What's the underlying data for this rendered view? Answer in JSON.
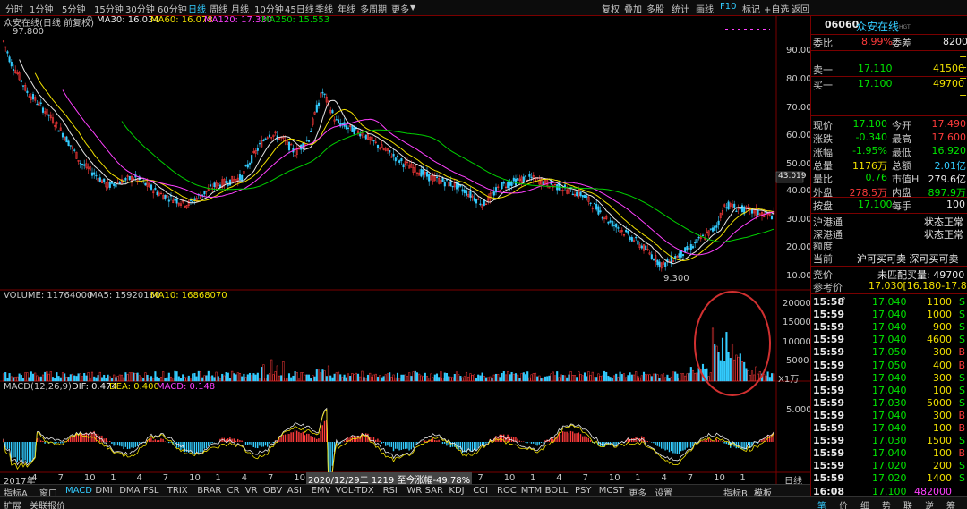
{
  "toolbar": {
    "timeframes": [
      "分时",
      "1分钟",
      "5分钟",
      "15分钟",
      "30分钟",
      "60分钟",
      "日线",
      "周线",
      "月线",
      "10分钟",
      "45日线",
      "季线",
      "年线",
      "多周期",
      "更多"
    ],
    "active_timeframe": "日线",
    "tools": [
      "复权",
      "叠加",
      "多股",
      "统计",
      "画线",
      "F10",
      "标记",
      "+自选",
      "返回"
    ]
  },
  "chart_header": {
    "stock_name": "众安在线(日线 前复权)",
    "ma30": "MA30: 16.034",
    "ma60": "MA60: 16.078",
    "ma120": "MA120: 17.330",
    "ma250": "MA250: 15.553",
    "high_marker": "97.800",
    "low_marker": "9.300",
    "current_price_box": "43.019"
  },
  "price_axis": [
    "90.00",
    "80.00",
    "70.00",
    "60.00",
    "50.00",
    "40.00",
    "30.00",
    "20.00",
    "10.00"
  ],
  "volume_header": {
    "volume": "VOLUME: 11764000",
    "ma5": "MA5: 15920160",
    "ma10": "MA10: 16868070"
  },
  "volume_axis": [
    "20000",
    "15000",
    "10000",
    "5000",
    "X1万"
  ],
  "macd_header": {
    "macd_label": "MACD(12,26,9)",
    "dif": "DIF: 0.474",
    "dea": "DEA: 0.400",
    "macd": "MACD: 0.148"
  },
  "macd_axis": [
    "5.000"
  ],
  "x_axis": [
    "2017年",
    "4",
    "7",
    "10",
    "1",
    "4",
    "7",
    "10",
    "1",
    "4",
    "7",
    "10",
    "1",
    "4",
    "7",
    "10",
    "1",
    "4",
    "7",
    "10",
    "1",
    "4",
    "7",
    "10",
    "1",
    "4",
    "7",
    "10",
    "1",
    "日线"
  ],
  "cursor_info": "2020/12/29二 1219 至今涨幅-49.78%",
  "indicator_tabs": [
    "指标A",
    "窗口",
    "MACD",
    "DMI",
    "DMA",
    "FSL",
    "TRIX",
    "BRAR",
    "CR",
    "VR",
    "OBV",
    "ASI",
    "EMV",
    "VOL-TDX",
    "RSI",
    "WR",
    "SAR",
    "KDJ",
    "CCI",
    "ROC",
    "MTM",
    "BOLL",
    "PSY",
    "MCST",
    "更多",
    "设置"
  ],
  "active_indicator": "MACD",
  "indicator_tabs_right": [
    "指标B",
    "模板"
  ],
  "bottom_tabs": [
    "扩展",
    "关联报价"
  ],
  "bottom_right_tabs": [
    "笔",
    "价",
    "细",
    "势",
    "联",
    "逆",
    "筹"
  ],
  "quote": {
    "code": "06060",
    "name": "众安在线",
    "weibi_label": "委比",
    "weibi_value": "8.99%",
    "weicha_label": "委差",
    "weicha_value": "8200",
    "ask1_label": "卖一",
    "ask1_price": "17.110",
    "ask1_vol": "41500",
    "bid1_label": "买一",
    "bid1_price": "17.100",
    "bid1_vol": "49700",
    "stats": [
      {
        "l1": "现价",
        "v1": "17.100",
        "c1": "green",
        "l2": "今开",
        "v2": "17.490",
        "c2": "red"
      },
      {
        "l1": "涨跌",
        "v1": "-0.340",
        "c1": "green",
        "l2": "最高",
        "v2": "17.600",
        "c2": "red"
      },
      {
        "l1": "涨幅",
        "v1": "-1.95%",
        "c1": "green",
        "l2": "最低",
        "v2": "16.920",
        "c2": "green"
      },
      {
        "l1": "总量",
        "v1": "1176万",
        "c1": "yellow",
        "l2": "总额",
        "v2": "2.01亿",
        "c2": "cyan"
      },
      {
        "l1": "量比",
        "v1": "0.76",
        "c1": "green",
        "l2": "市值H",
        "v2": "279.6亿",
        "c2": "white"
      },
      {
        "l1": "外盘",
        "v1": "278.5万",
        "c1": "red",
        "l2": "内盘",
        "v2": "897.9万",
        "c2": "green"
      }
    ],
    "lot_label": "按盘",
    "lot_price": "17.100",
    "per_hand_label": "每手",
    "per_hand_value": "100",
    "hk_connect": [
      {
        "label": "沪港通",
        "value": "状态正常"
      },
      {
        "label": "深港通",
        "value": "状态正常"
      },
      {
        "label": "额度",
        "value": ""
      },
      {
        "label": "当前",
        "value": "沪可买可卖 深可买可卖"
      }
    ],
    "auction_label": "竞价",
    "auction_value": "未匹配买量: 49700",
    "ref_label": "参考价",
    "ref_value": "17.030[16.180-17.880]",
    "ticks": [
      {
        "t": "15:58",
        "p": "17.040",
        "v": "1100",
        "d": "S",
        "q": true
      },
      {
        "t": "15:59",
        "p": "17.040",
        "v": "1000",
        "d": "S"
      },
      {
        "t": "15:59",
        "p": "17.040",
        "v": "900",
        "d": "S"
      },
      {
        "t": "15:59",
        "p": "17.040",
        "v": "4600",
        "d": "S"
      },
      {
        "t": "15:59",
        "p": "17.050",
        "v": "300",
        "d": "B"
      },
      {
        "t": "15:59",
        "p": "17.050",
        "v": "400",
        "d": "B"
      },
      {
        "t": "15:59",
        "p": "17.040",
        "v": "300",
        "d": "S"
      },
      {
        "t": "15:59",
        "p": "17.040",
        "v": "100",
        "d": "S"
      },
      {
        "t": "15:59",
        "p": "17.030",
        "v": "5000",
        "d": "S"
      },
      {
        "t": "15:59",
        "p": "17.040",
        "v": "300",
        "d": "B"
      },
      {
        "t": "15:59",
        "p": "17.040",
        "v": "100",
        "d": "B"
      },
      {
        "t": "15:59",
        "p": "17.030",
        "v": "1500",
        "d": "S"
      },
      {
        "t": "15:59",
        "p": "17.040",
        "v": "100",
        "d": "B"
      },
      {
        "t": "15:59",
        "p": "17.020",
        "v": "200",
        "d": "S"
      },
      {
        "t": "15:59",
        "p": "17.020",
        "v": "1400",
        "d": "S"
      },
      {
        "t": "16:08",
        "p": "17.100",
        "v": "482000",
        "d": ""
      }
    ]
  },
  "colors": {
    "up": "#ff3b3b",
    "down": "#33ccff",
    "ma30": "#e8e8e8",
    "ma60": "#f0e000",
    "ma120": "#ff40ff",
    "ma250": "#00d000",
    "border": "#7a0000",
    "annotation": "#d03030"
  }
}
